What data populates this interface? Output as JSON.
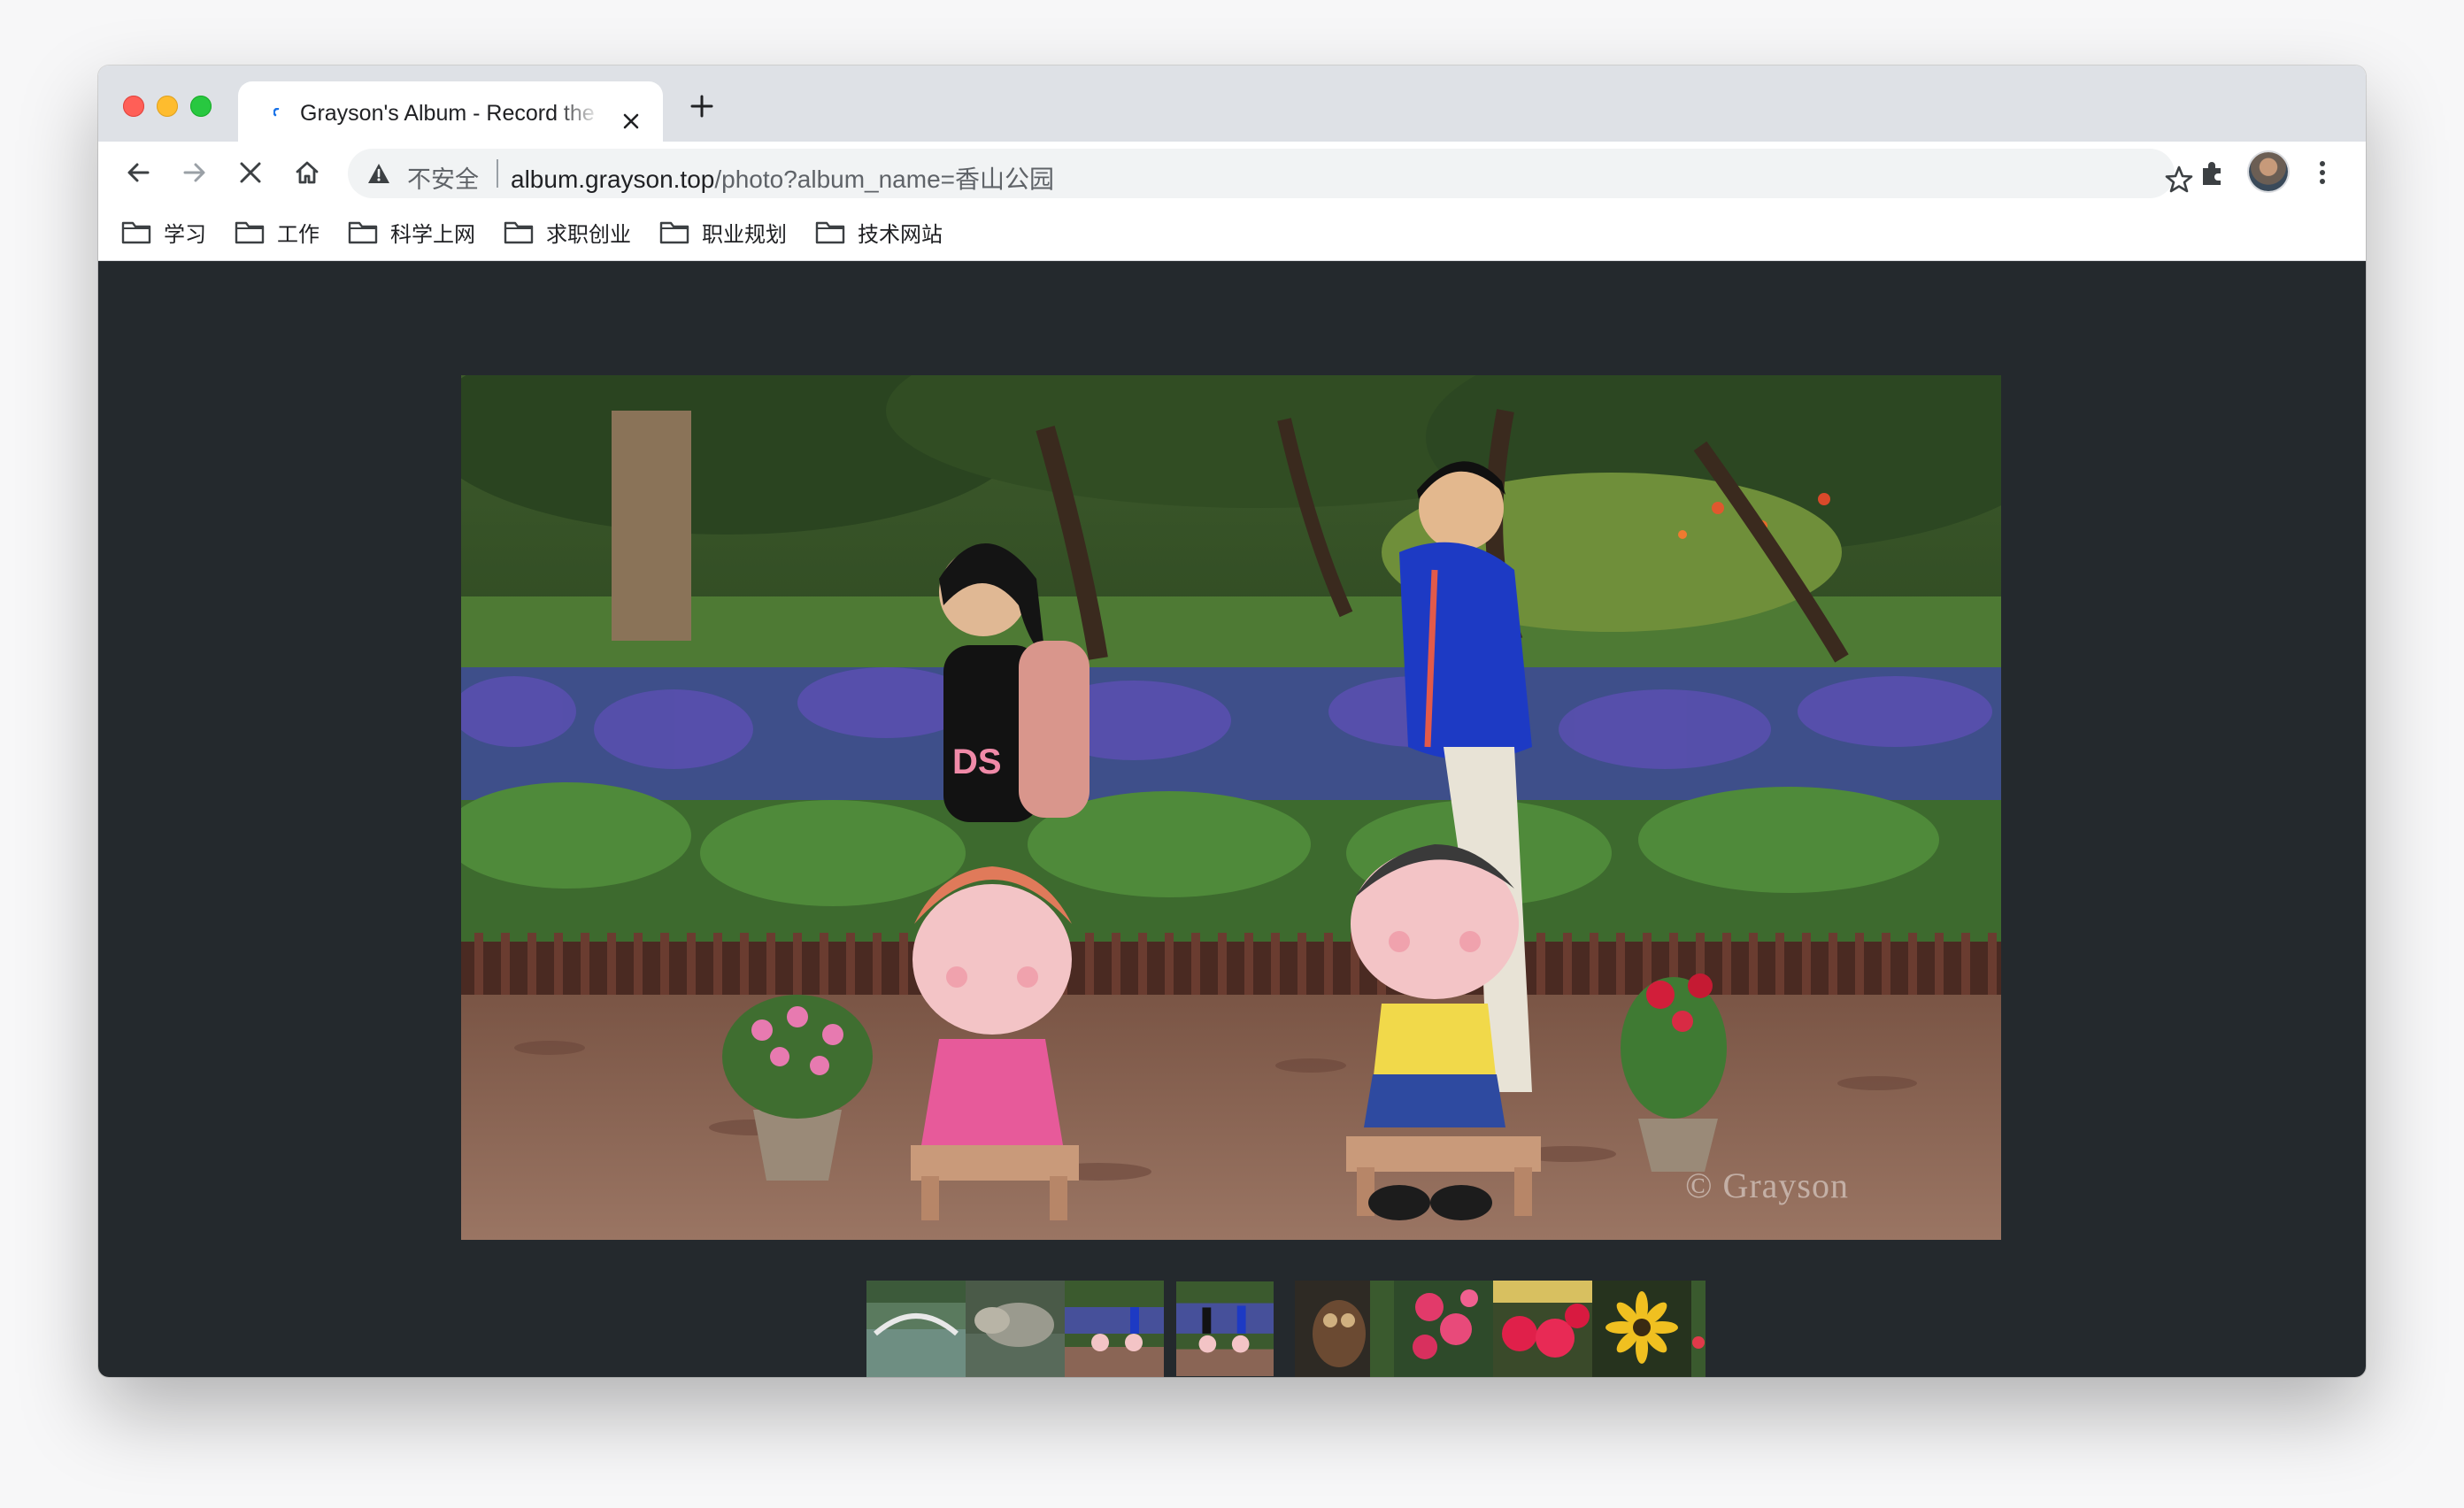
{
  "browser": {
    "tab": {
      "title": "Grayson's Album - Record the beautiful life"
    },
    "toolbar": {
      "security_label": "不安全",
      "url_host": "album.grayson.top",
      "url_path": "/photo?album_name=香山公园"
    },
    "bookmarks": [
      {
        "label": "学习",
        "icon": "folder-icon"
      },
      {
        "label": "工作",
        "icon": "folder-icon"
      },
      {
        "label": "科学上网",
        "icon": "folder-icon"
      },
      {
        "label": "求职创业",
        "icon": "folder-icon"
      },
      {
        "label": "职业规划",
        "icon": "folder-icon"
      },
      {
        "label": "技术网站",
        "icon": "folder-icon"
      }
    ]
  },
  "gallery": {
    "album_name": "香山公园",
    "watermark": "© Grayson",
    "main_photo_description_icon": "photo-children-with-statues",
    "thumbnails": [
      {
        "icon": "thumb-bridge-lake",
        "selected": false
      },
      {
        "icon": "thumb-rocks-pond",
        "selected": false
      },
      {
        "icon": "thumb-children-statues",
        "selected": false
      },
      {
        "icon": "thumb-children-statues-2",
        "selected": true
      },
      {
        "icon": "thumb-owl-statue",
        "selected": false
      },
      {
        "icon": "thumb-red-flowers",
        "selected": false
      },
      {
        "icon": "thumb-red-azalea",
        "selected": false
      },
      {
        "icon": "thumb-sunflower",
        "selected": false
      },
      {
        "icon": "thumb-garden-flowers",
        "selected": false
      }
    ]
  },
  "colors": {
    "page_background": "#24292d",
    "tabstrip": "#dee1e6",
    "omnibox": "#f1f3f4"
  }
}
